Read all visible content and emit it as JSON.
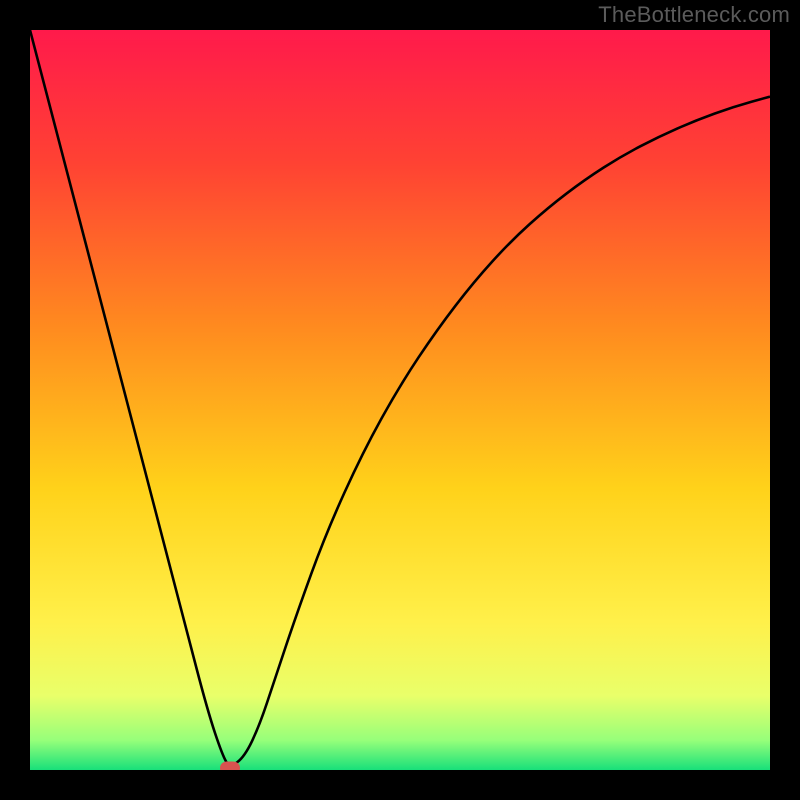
{
  "watermark": "TheBottleneck.com",
  "chart_data": {
    "type": "line",
    "title": "",
    "xlabel": "",
    "ylabel": "",
    "xlim": [
      0,
      100
    ],
    "ylim": [
      0,
      100
    ],
    "gradient_stops": [
      {
        "offset": 0,
        "color": "#ff1a4b"
      },
      {
        "offset": 18,
        "color": "#ff4233"
      },
      {
        "offset": 40,
        "color": "#ff8a1f"
      },
      {
        "offset": 62,
        "color": "#ffd21a"
      },
      {
        "offset": 80,
        "color": "#fff04a"
      },
      {
        "offset": 90,
        "color": "#e9ff6a"
      },
      {
        "offset": 96,
        "color": "#96ff7a"
      },
      {
        "offset": 100,
        "color": "#18e07a"
      }
    ],
    "series": [
      {
        "name": "bottleneck-curve",
        "x": [
          0,
          3,
          6,
          9,
          12,
          15,
          18,
          21,
          24,
          26,
          27,
          29,
          31,
          33,
          36,
          40,
          45,
          50,
          55,
          60,
          65,
          70,
          75,
          80,
          85,
          90,
          95,
          100
        ],
        "y": [
          100,
          88.5,
          77,
          65.5,
          54,
          42.5,
          31,
          19.5,
          8,
          2,
          0.3,
          1.8,
          6,
          12,
          21,
          32,
          43,
          52,
          59.5,
          66,
          71.5,
          76,
          79.8,
          83,
          85.6,
          87.8,
          89.6,
          91
        ]
      }
    ],
    "marker": {
      "x": 27,
      "y": 0.3,
      "color": "#d9534f"
    }
  }
}
